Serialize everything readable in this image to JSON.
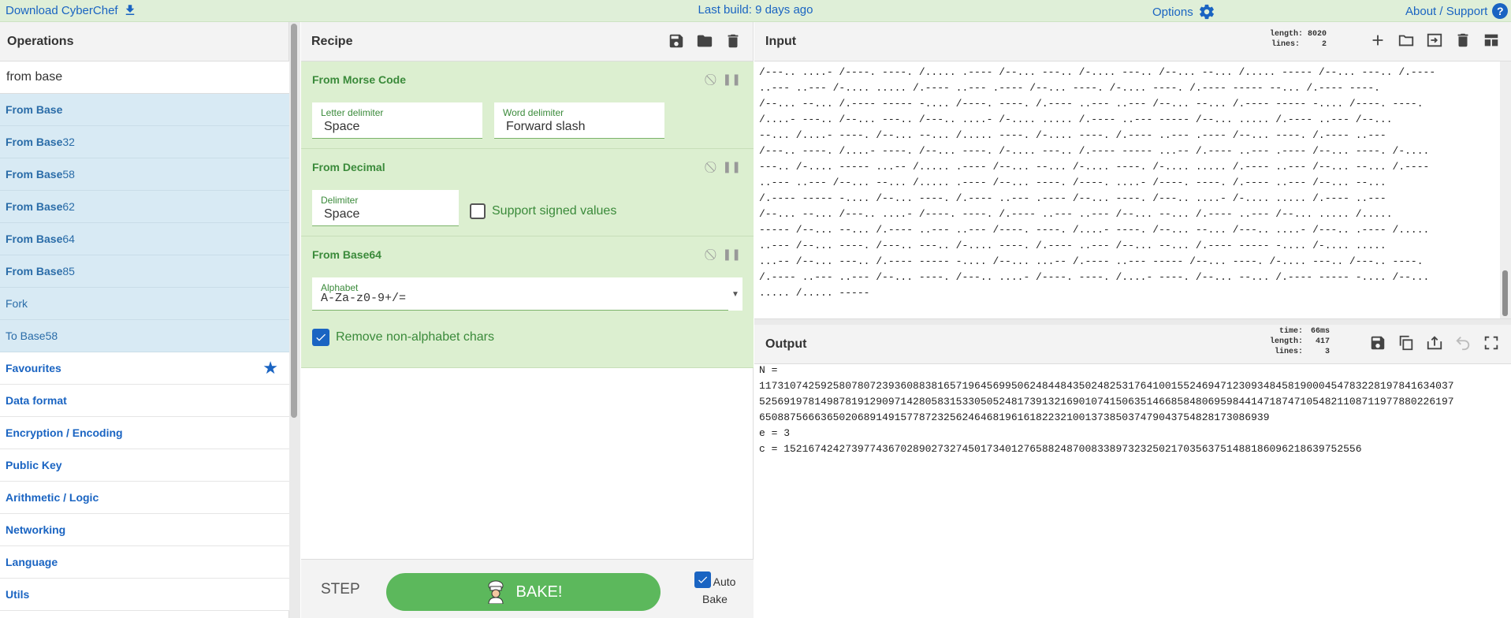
{
  "banner": {
    "download_label": "Download CyberChef",
    "last_build": "Last build: 9 days ago",
    "options_label": "Options",
    "about_label": "About / Support"
  },
  "operations": {
    "title": "Operations",
    "search_value": "from base",
    "results": [
      {
        "bold": "From Base",
        "rest": ""
      },
      {
        "bold": "From Base",
        "rest": "32"
      },
      {
        "bold": "From Base",
        "rest": "58"
      },
      {
        "bold": "From Base",
        "rest": "62"
      },
      {
        "bold": "From Base",
        "rest": "64"
      },
      {
        "bold": "From Base",
        "rest": "85"
      },
      {
        "bold": "",
        "rest": "Fork"
      },
      {
        "bold": "",
        "rest": "To Base58"
      }
    ],
    "categories": [
      "Favourites",
      "Data format",
      "Encryption / Encoding",
      "Public Key",
      "Arithmetic / Logic",
      "Networking",
      "Language",
      "Utils"
    ]
  },
  "recipe": {
    "title": "Recipe",
    "ops": {
      "morse": {
        "name": "From Morse Code",
        "letter_delim_label": "Letter delimiter",
        "letter_delim_value": "Space",
        "word_delim_label": "Word delimiter",
        "word_delim_value": "Forward slash"
      },
      "decimal": {
        "name": "From Decimal",
        "delim_label": "Delimiter",
        "delim_value": "Space",
        "signed_label": "Support signed values"
      },
      "base64": {
        "name": "From Base64",
        "alphabet_label": "Alphabet",
        "alphabet_value": "A-Za-z0-9+/=",
        "remove_label": "Remove non-alphabet chars"
      }
    },
    "step_label": "STEP",
    "bake_label": "BAKE!",
    "autobake_label": "Auto Bake"
  },
  "input": {
    "title": "Input",
    "length_label": "length:",
    "length_value": "8020",
    "lines_label": "lines:",
    "lines_value": "2",
    "text": "/---.. ....- /----. ----. /..... .---- /--... ---.. /-.... ---.. /--... --... /..... ----- /--... ---.. /.----\n..--- ..--- /-.... ..... /.---- ..--- .---- /--... ----. /-.... ----. /.---- ----- --... /.---- ----.\n/--... --... /.---- ----- -.... /----. ----. /.---- ..--- ..--- /--... --... /.---- ----- -.... /----. ----.\n/....- ---.. /--... ---.. /---.. ....- /-.... ..... /.---- ..--- ----- /--... ..... /.---- ..--- /--...\n--... /....- ----. /--... --... /..... ----. /-.... ----. /.---- ..--- .---- /--... ----. /.---- ..---\n/---.. ----. /....- ----. /--... ----. /-.... ---.. /.---- ----- ...-- /.---- ..--- .---- /--... ----. /-....\n---.. /-.... ----- ...-- /..... .---- /--... --... /-.... ----. /-.... ..... /.---- ..--- /--... --... /.----\n..--- ..--- /--... --... /..... .---- /--... ----. /----. ....- /----. ----. /.---- ..--- /--... --...\n/.---- ----- -.... /--... ----. /.---- ..--- .---- /--... ----. /---.. ....- /-.... ..... /.---- ..---\n/--... --... /---.. ....- /----. ----. /.---- ..--- ..--- /--... --... /.---- ..--- /--... ..... /.....\n----- /--... --... /.---- ..--- ..--- /----. ----. /....- ----. /--... --... /---.. ....- /---.. .---- /.....\n..--- /--... ----. /---.. ---.. /-.... ----. /.---- ..--- /--... --... /.---- ----- -.... /-.... .....\n...-- /--... ---.. /.---- ----- -.... /--... ...-- /.---- ..--- ----- /--... ----. /-.... ---.. /---.. ----.\n/.---- ..--- ..--- /--... ----. /---.. ....- /----. ----. /....- ----. /--... --... /.---- ----- -.... /--...\n..... /..... -----"
  },
  "output": {
    "title": "Output",
    "time_label": "time:",
    "time_value": "66ms",
    "length_label": "length:",
    "length_value": "417",
    "lines_label": "lines:",
    "lines_value": "3",
    "text": "N =\n11731074259258078072393608838165719645699506248448435024825317641001552469471230934845819000454783228197841634037\n52569197814987819129097142805831533050524817391321690107415063514668584806959844147187471054821108711977880226197\n65088756663650206891491577872325624646819616182232100137385037479043754828173086939\ne = 3\nc = 1521674242739774367028902732745017340127658824870083389732325021703563751488186096218639752556"
  },
  "colors": {
    "banner_bg": "#dfefd8",
    "op_card_bg": "#dcefd0",
    "search_result_bg": "#d8eaf4",
    "bake_green": "#5cb85c",
    "link_blue": "#1a64c2"
  }
}
